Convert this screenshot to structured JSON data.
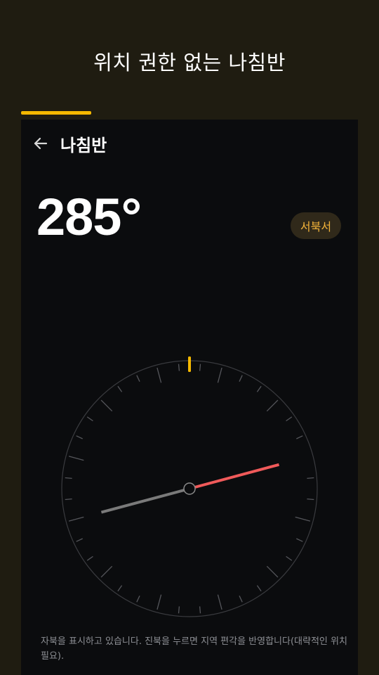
{
  "banner": {
    "title": "위치 권한 없는 나침반",
    "progress_fraction": 0.2
  },
  "appbar": {
    "back_icon": "arrow-left-icon",
    "title": "나침반"
  },
  "heading": {
    "value": "285°",
    "degrees": 285,
    "direction_label": "서북서"
  },
  "compass": {
    "north_marker_icon": "north-marker-icon",
    "needle_north_color": "#f05a5a",
    "needle_south_color": "#7a7a7a",
    "accent_color": "#f5b800"
  },
  "hint": {
    "text": "자북을 표시하고 있습니다. 진북을 누르면 지역 편각을 반영합니다(대략적인 위치 필요)."
  },
  "colors": {
    "background": "#1f1c11",
    "screen": "#0b0c0e",
    "accent": "#f5b800",
    "chip_bg": "#30291a",
    "chip_text": "#f2b33a"
  }
}
